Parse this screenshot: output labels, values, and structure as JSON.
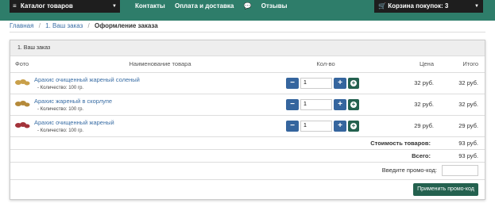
{
  "nav": {
    "catalog_label": "Каталог товаров",
    "links": [
      "Контакты",
      "Оплата и доставка",
      "Отзывы"
    ],
    "cart_label": "Корзина покупок: 3"
  },
  "breadcrumb": {
    "home": "Главная",
    "step1": "1. Ваш заказ",
    "current": "Оформление заказа"
  },
  "order": {
    "title": "1. Ваш заказ",
    "columns": {
      "photo": "Фото",
      "name": "Наименование товара",
      "qty": "Кол-во",
      "price": "Цена",
      "total": "Итого"
    },
    "items": [
      {
        "name": "Арахис очищенный жареный соленый",
        "qty_label": "- Количество: 100 гр.",
        "qty": "1",
        "price": "32 руб.",
        "total": "32 руб.",
        "img_color": "#c9a04a"
      },
      {
        "name": "Арахис жареный в скорлупе",
        "qty_label": "- Количество: 100 гр.",
        "qty": "1",
        "price": "32 руб.",
        "total": "32 руб.",
        "img_color": "#b58a3a"
      },
      {
        "name": "Арахис очищенный жареный",
        "qty_label": "- Количество: 100 гр.",
        "qty": "1",
        "price": "29 руб.",
        "total": "29 руб.",
        "img_color": "#a3333a"
      }
    ],
    "goods_cost_label": "Стоимость товаров:",
    "goods_cost_value": "93 руб.",
    "total_label": "Всего:",
    "total_value": "93 руб.",
    "promo_label": "Введите промо-код:",
    "promo_value": "",
    "apply_label": "Применить промо-код"
  },
  "colors": {
    "nav_green": "#2e7d6a",
    "dark": "#1e1e1e",
    "blue_btn": "#35659e",
    "green_btn": "#24614f",
    "link": "#3a6ea5"
  }
}
